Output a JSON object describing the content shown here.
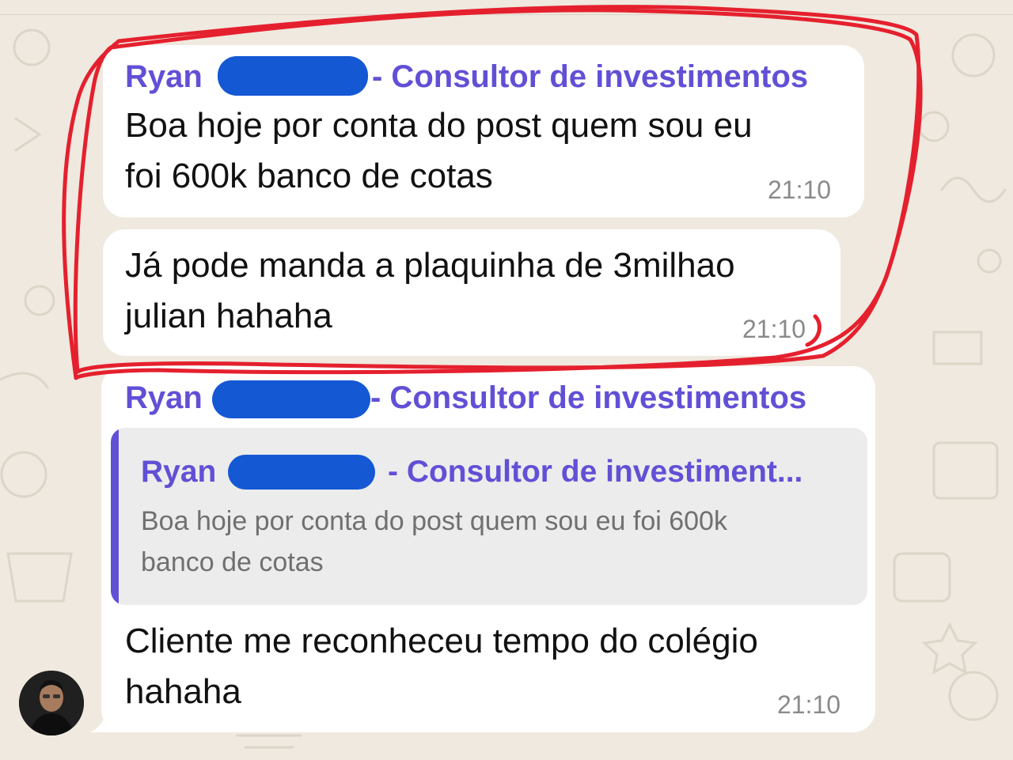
{
  "chat": {
    "messages": [
      {
        "sender": "Ryan",
        "sender_suffix": "- Consultor de investimentos",
        "lines": [
          "Boa hoje por conta do post quem sou eu",
          "foi 600k banco de cotas"
        ],
        "time": "21:10"
      },
      {
        "lines": [
          "Já pode manda a plaquinha de 3milhao",
          "julian hahaha"
        ],
        "time": "21:10"
      },
      {
        "sender": "Ryan",
        "sender_suffix": "- Consultor de investimentos",
        "reply": {
          "sender": "Ryan",
          "sender_suffix": "- Consultor de investiment...",
          "lines": [
            "Boa hoje por conta do post quem sou eu foi 600k",
            "banco de cotas"
          ]
        },
        "lines": [
          "Cliente me reconheceu tempo do colégio",
          "hahaha"
        ],
        "time": "21:10"
      }
    ]
  },
  "colors": {
    "background": "#efe9df",
    "bubble": "#ffffff",
    "sender_name": "#6150d6",
    "redaction": "#1458d4",
    "highlight": "#e5202e",
    "quote_background": "#ececec",
    "timestamp": "#8a8a8a"
  },
  "icons": {
    "avatar": "profile-photo",
    "highlight": "red-circle-annotation",
    "redaction": "blue-scribble-redaction"
  }
}
